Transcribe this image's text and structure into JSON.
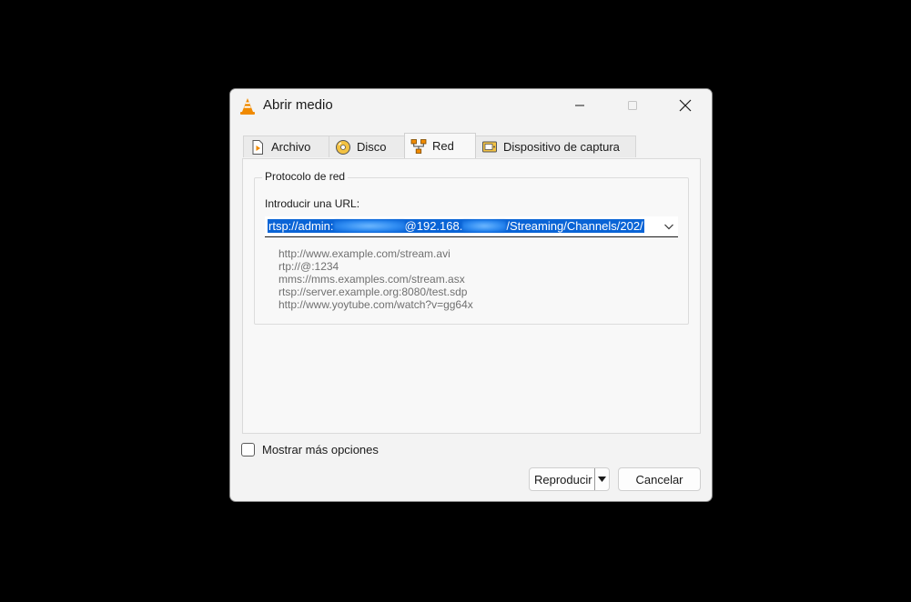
{
  "window": {
    "title": "Abrir medio",
    "app_icon": "vlc-cone-icon"
  },
  "tabs": [
    {
      "label": "Archivo",
      "icon": "file-play-icon"
    },
    {
      "label": "Disco",
      "icon": "disc-icon"
    },
    {
      "label": "Red",
      "icon": "network-icon",
      "active": true
    },
    {
      "label": "Dispositivo de captura",
      "icon": "capture-device-icon"
    }
  ],
  "network": {
    "group_title": "Protocolo de red",
    "url_label": "Introducir una URL:",
    "url_part1": "rtsp://admin:",
    "url_part2": "@192.168.",
    "url_part3": "/Streaming/Channels/202/",
    "examples": [
      "http://www.example.com/stream.avi",
      "rtp://@:1234",
      "mms://mms.examples.com/stream.asx",
      "rtsp://server.example.org:8080/test.sdp",
      "http://www.yoytube.com/watch?v=gg64x"
    ]
  },
  "options": {
    "more_options_label": "Mostrar más opciones",
    "checked": false
  },
  "buttons": {
    "play_label": "Reproducir",
    "cancel_label": "Cancelar"
  },
  "colors": {
    "selection": "#0a64d6",
    "vlc_orange": "#f08a00"
  }
}
